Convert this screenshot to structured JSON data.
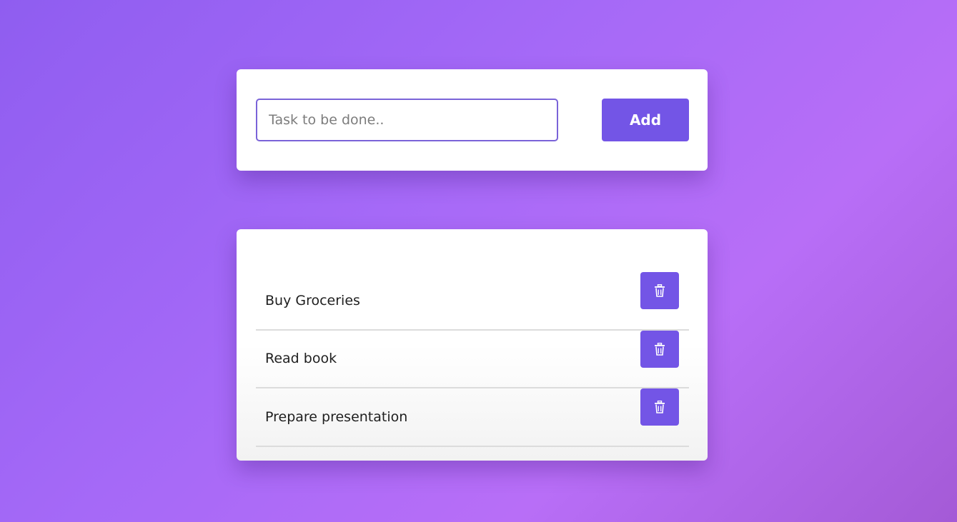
{
  "form": {
    "input_placeholder": "Task to be done..",
    "input_value": "",
    "add_label": "Add"
  },
  "tasks": [
    {
      "label": "Buy Groceries",
      "delete_icon": "trash-icon"
    },
    {
      "label": "Read book",
      "delete_icon": "trash-icon"
    },
    {
      "label": "Prepare presentation",
      "delete_icon": "trash-icon"
    }
  ],
  "colors": {
    "accent": "#7355e6",
    "background_gradient_start": "#8f5df0",
    "background_gradient_end": "#b86ef7",
    "card": "#ffffff",
    "divider": "#dcdcdc"
  }
}
